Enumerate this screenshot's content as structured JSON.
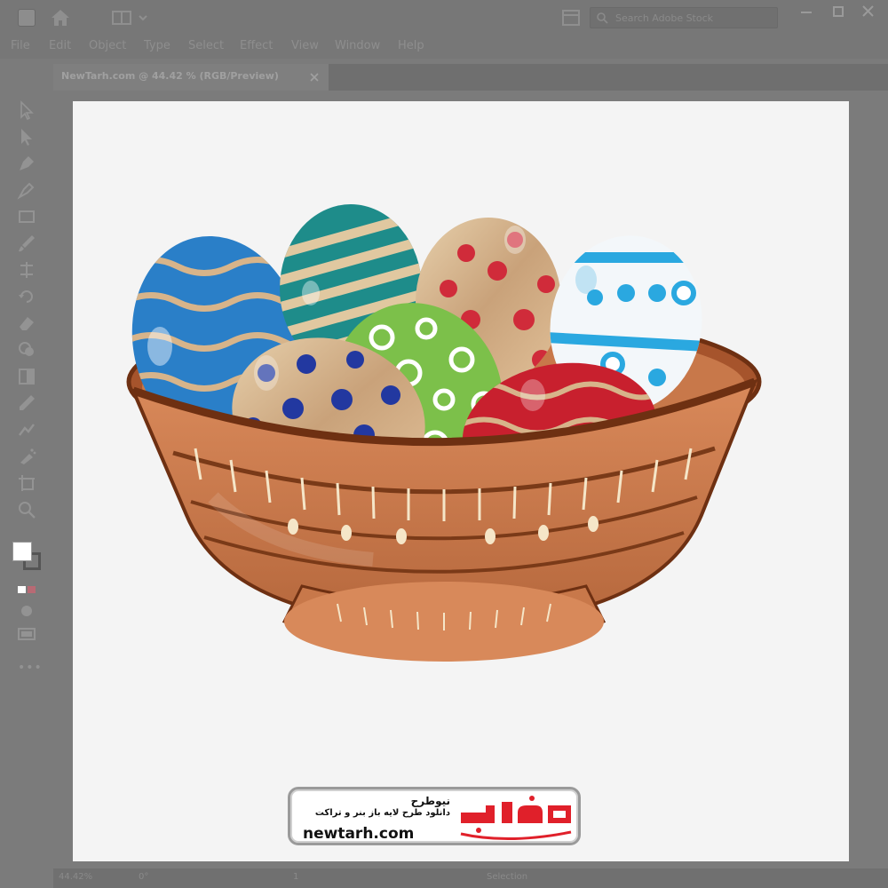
{
  "app": {
    "search_placeholder": "Search Adobe Stock"
  },
  "menu": {
    "items": [
      "File",
      "Edit",
      "Object",
      "Type",
      "Select",
      "Effect",
      "View",
      "Window",
      "Help"
    ]
  },
  "document": {
    "tab_title": "NewTarh.com @ 44.42 % (RGB/Preview)"
  },
  "statusbar": {
    "zoom": "44.42%",
    "angle": "0°",
    "page": "1",
    "mode": "Selection"
  },
  "artwork": {
    "description_icons": [
      "easter-egg-basket"
    ],
    "colors": {
      "bowl": "#c8784a",
      "bowl_dark": "#7a3a18",
      "egg_blue": "#2a7fc8",
      "egg_green": "#7cc04a",
      "egg_red": "#c8202e",
      "egg_gold": "#d8b88e",
      "egg_teal": "#1e8c8a",
      "egg_light_blue": "#2aa8e0"
    }
  },
  "watermark": {
    "brand_fa": "نیوطرح",
    "tagline_fa": "دانلود طرح لایه باز بنر و تراکت",
    "url": "newtarh.com",
    "logo_text_fa": "نیوطرح",
    "logo_color": "#e0202a"
  }
}
